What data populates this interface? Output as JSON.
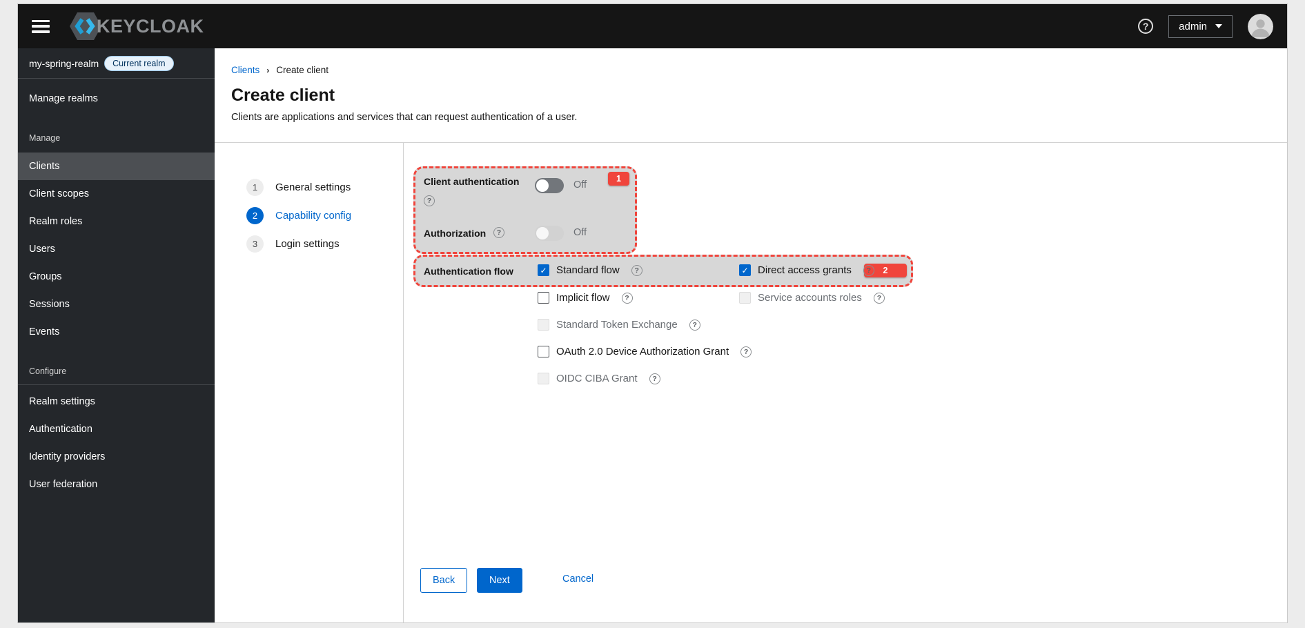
{
  "masthead": {
    "brand": "KEYCLOAK",
    "user": "admin"
  },
  "sidebar": {
    "realm_name": "my-spring-realm",
    "realm_badge": "Current realm",
    "manage_realms": "Manage realms",
    "manage_section": "Manage",
    "configure_section": "Configure",
    "manage_items": [
      "Clients",
      "Client scopes",
      "Realm roles",
      "Users",
      "Groups",
      "Sessions",
      "Events"
    ],
    "configure_items": [
      "Realm settings",
      "Authentication",
      "Identity providers",
      "User federation"
    ]
  },
  "breadcrumb": {
    "parent": "Clients",
    "current": "Create client"
  },
  "page": {
    "title": "Create client",
    "description": "Clients are applications and services that can request authentication of a user."
  },
  "wizard": {
    "steps": [
      {
        "number": "1",
        "label": "General settings"
      },
      {
        "number": "2",
        "label": "Capability config"
      },
      {
        "number": "3",
        "label": "Login settings"
      }
    ]
  },
  "form": {
    "client_auth_label": "Client authentication",
    "client_auth_value": "Off",
    "authorization_label": "Authorization",
    "authorization_value": "Off",
    "auth_flow_label": "Authentication flow",
    "flows": {
      "standard": "Standard flow",
      "direct": "Direct access grants",
      "implicit": "Implicit flow",
      "service": "Service accounts roles",
      "token_exchange": "Standard Token Exchange",
      "device": "OAuth 2.0 Device Authorization Grant",
      "ciba": "OIDC CIBA Grant"
    },
    "back": "Back",
    "next": "Next",
    "cancel": "Cancel"
  },
  "annotations": {
    "badge_1": "1",
    "badge_2": "2",
    "highlight_color": "#f0453c"
  }
}
